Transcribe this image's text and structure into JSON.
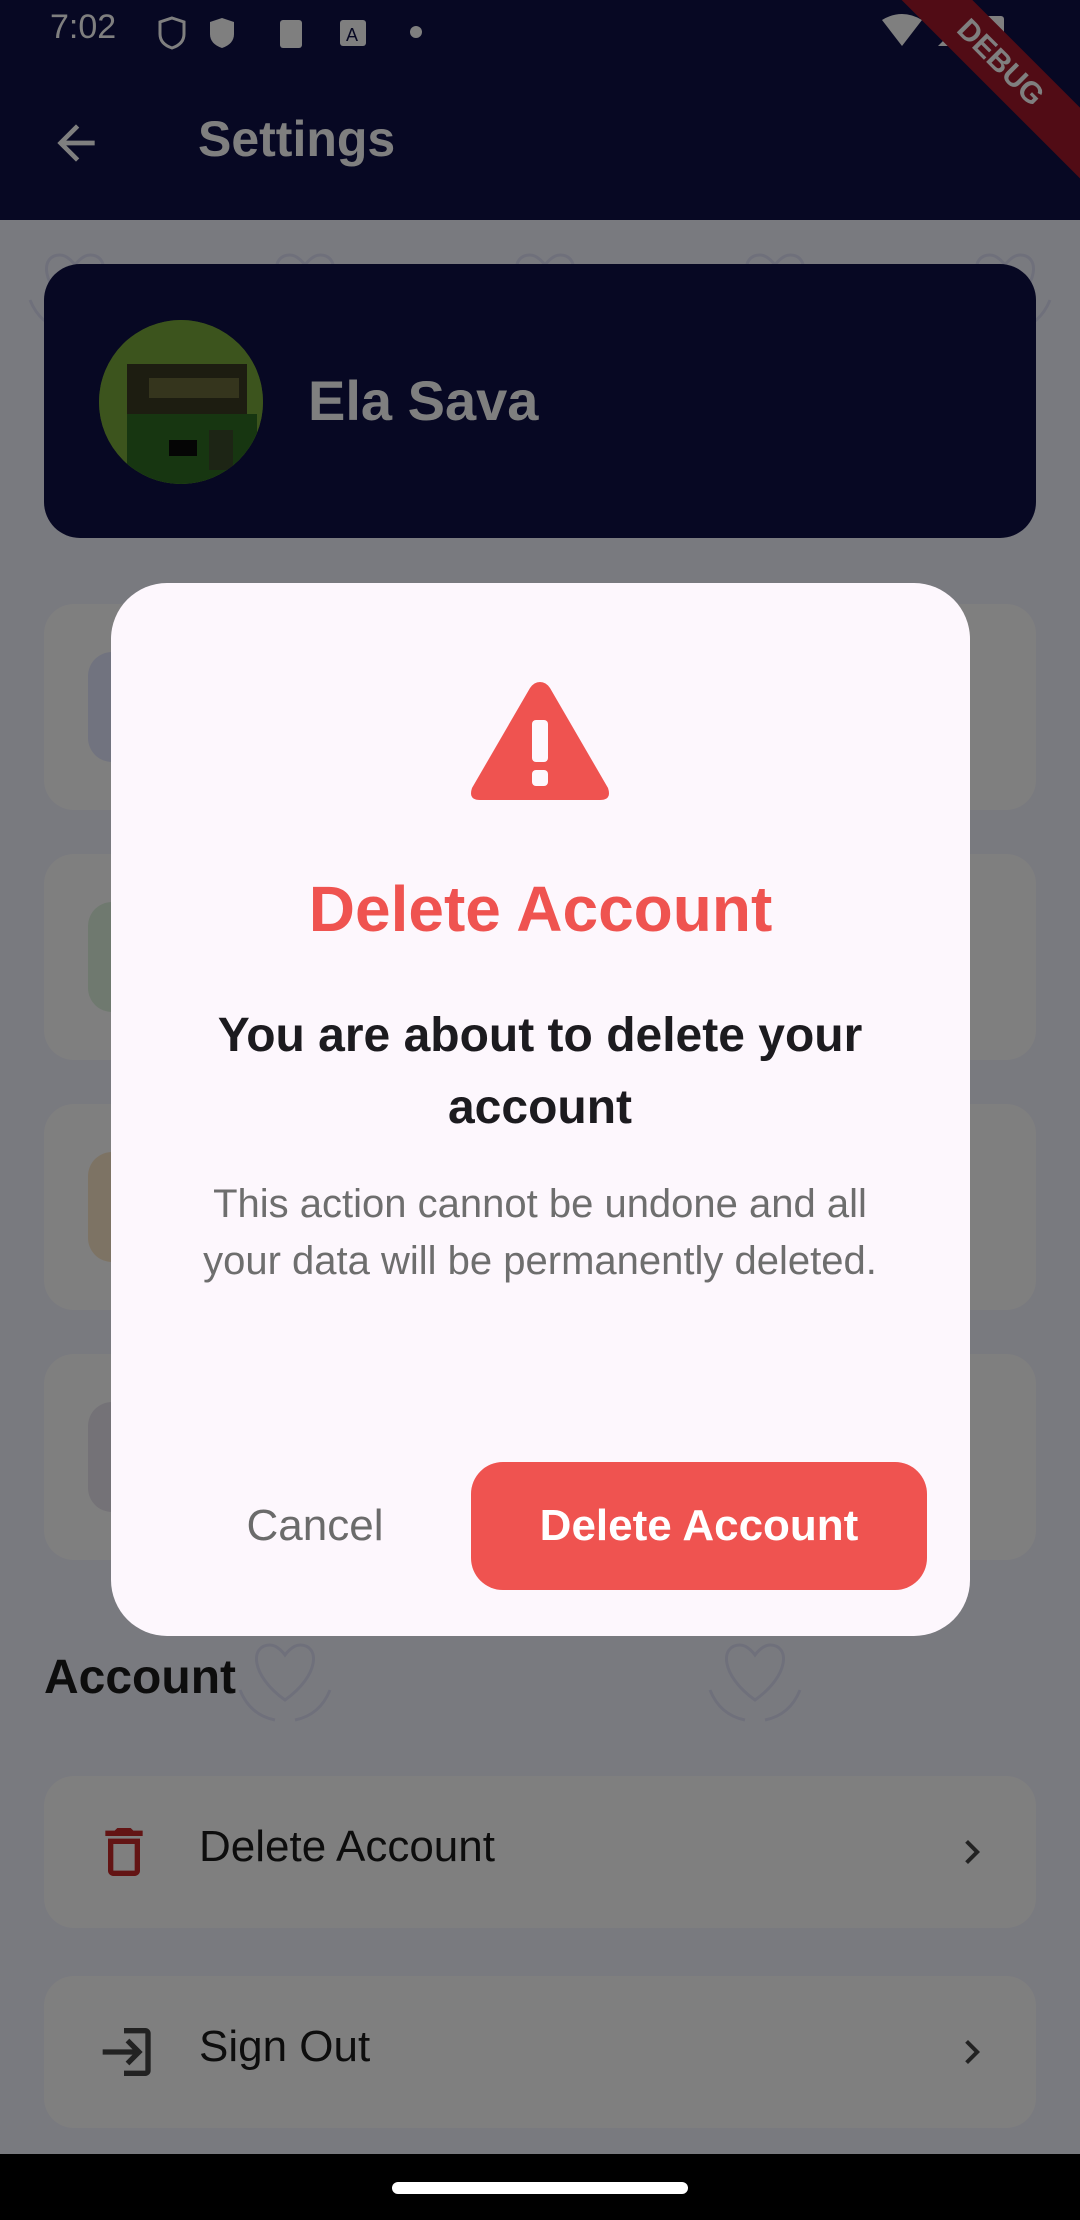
{
  "status_bar": {
    "time": "7:02"
  },
  "app_bar": {
    "title": "Settings",
    "debug_label": "DEBUG"
  },
  "profile": {
    "name": "Ela Sava"
  },
  "account_section": {
    "title": "Account",
    "items": [
      {
        "label": "Delete Account",
        "icon": "trash-icon"
      },
      {
        "label": "Sign Out",
        "icon": "logout-icon"
      }
    ]
  },
  "dialog": {
    "icon": "warning-icon",
    "title": "Delete Account",
    "heading": "You are about to delete your account",
    "body": "This action cannot be undone and all your data will be permanently deleted.",
    "cancel_label": "Cancel",
    "confirm_label": "Delete Account"
  },
  "colors": {
    "primary": "#0f1147",
    "danger": "#ef5350",
    "dialog_bg": "#fdf7fd"
  }
}
